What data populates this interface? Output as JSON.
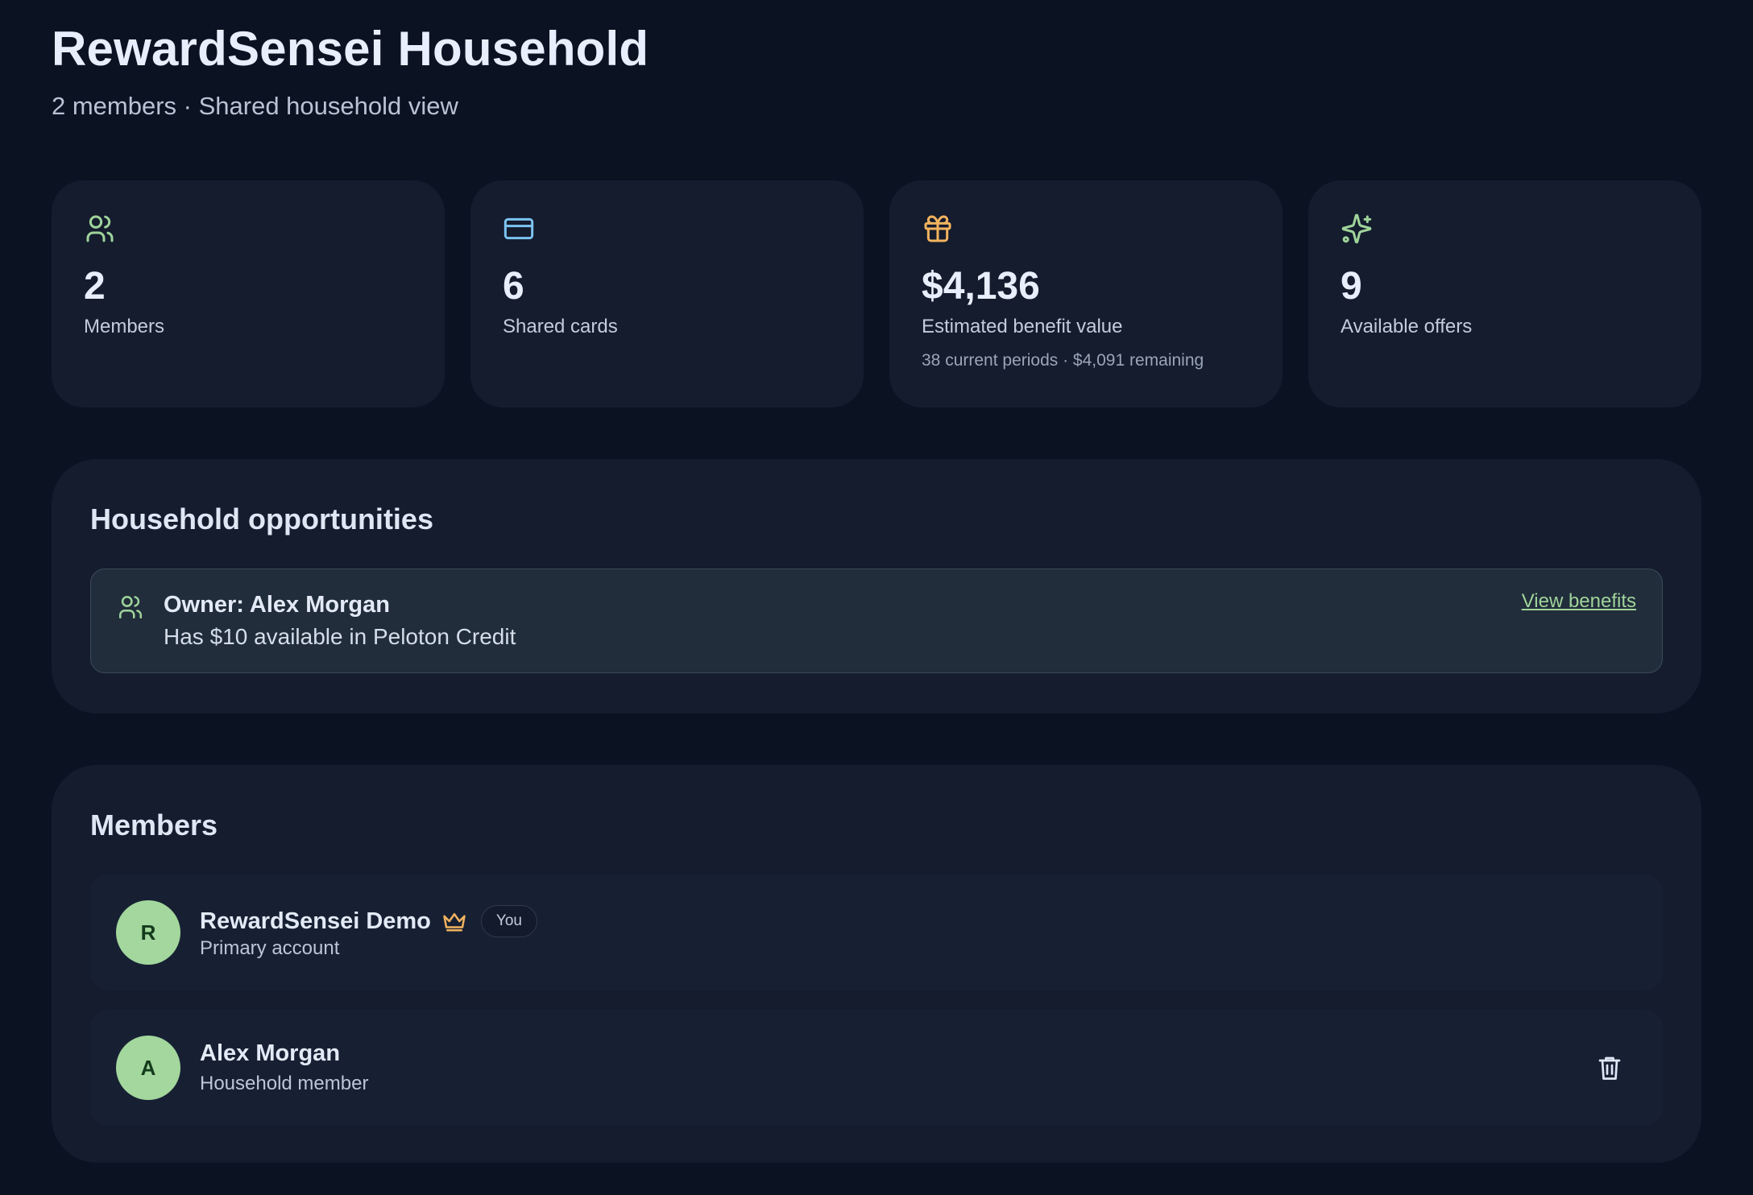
{
  "header": {
    "title": "RewardSensei Household",
    "subtitle": "2 members · Shared household view"
  },
  "stats": [
    {
      "icon": "users-icon",
      "value": "2",
      "label": "Members",
      "sub": "",
      "color": "#9fd49a"
    },
    {
      "icon": "credit-card-icon",
      "value": "6",
      "label": "Shared cards",
      "sub": "",
      "color": "#7cc3f0"
    },
    {
      "icon": "gift-icon",
      "value": "$4,136",
      "label": "Estimated benefit value",
      "sub": "38 current periods · $4,091 remaining",
      "color": "#f2b35e"
    },
    {
      "icon": "sparkles-icon",
      "value": "9",
      "label": "Available offers",
      "sub": "",
      "color": "#9fd49a"
    }
  ],
  "opportunities": {
    "title": "Household opportunities",
    "items": [
      {
        "owner": "Owner: Alex Morgan",
        "text": "Has $10 available in Peloton Credit",
        "link": "View benefits"
      }
    ]
  },
  "members": {
    "title": "Members",
    "items": [
      {
        "initial": "R",
        "name": "RewardSensei Demo",
        "role": "Primary account",
        "badge": "You",
        "owner": true
      },
      {
        "initial": "A",
        "name": "Alex Morgan",
        "role": "Household member",
        "badge": "",
        "owner": false
      }
    ]
  },
  "colors": {
    "background": "#0b1222",
    "card": "#141c2e",
    "accent_green": "#9fd49a",
    "accent_blue": "#7cc3f0",
    "accent_orange": "#f2b35e"
  }
}
